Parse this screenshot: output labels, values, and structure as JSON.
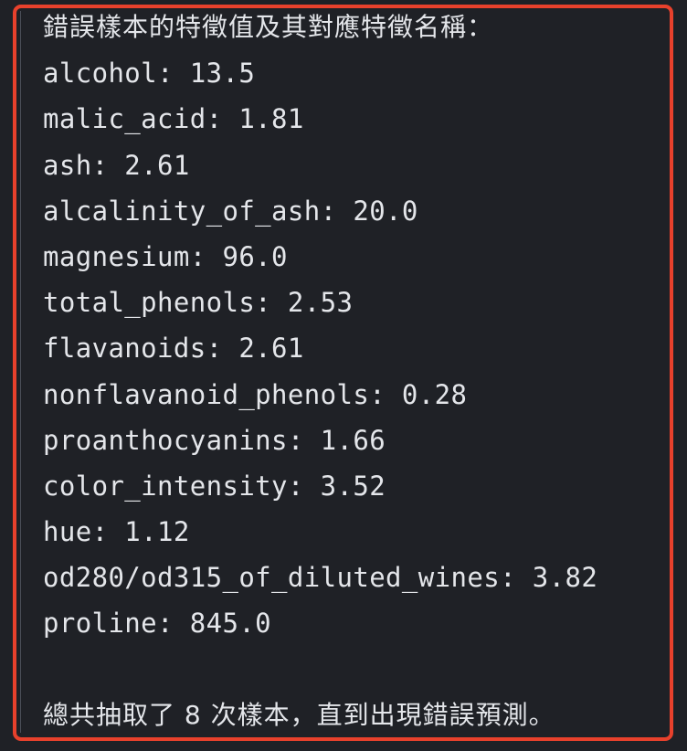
{
  "output": {
    "heading": "錯誤樣本的特徵值及其對應特徵名稱：",
    "features": [
      "alcohol: 13.5",
      "malic_acid: 1.81",
      "ash: 2.61",
      "alcalinity_of_ash: 20.0",
      "magnesium: 96.0",
      "total_phenols: 2.53",
      "flavanoids: 2.61",
      "nonflavanoid_phenols: 0.28",
      "proanthocyanins: 1.66",
      "color_intensity: 3.52",
      "hue: 1.12",
      "od280/od315_of_diluted_wines: 3.82",
      "proline: 845.0"
    ],
    "summary": "總共抽取了 8 次樣本，直到出現錯誤預測。"
  },
  "colors": {
    "background": "#1f2126",
    "text": "#e4e6ea",
    "highlight_border": "#e8412c"
  }
}
